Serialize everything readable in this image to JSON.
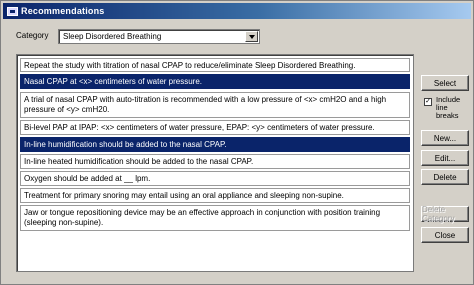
{
  "window": {
    "title": "Recommendations"
  },
  "category": {
    "label": "Category",
    "selected": "Sleep Disordered Breathing"
  },
  "recommendations": [
    {
      "text": "Repeat the study with titration of nasal CPAP to reduce/eliminate Sleep Disordered Breathing.",
      "selected": false
    },
    {
      "text": "Nasal CPAP at <x> centimeters of water pressure.",
      "selected": true
    },
    {
      "text": "A trial of nasal CPAP with auto-titration is recommended with a low pressure of <x> cmH2O and a high pressure of <y> cmH20.",
      "selected": false
    },
    {
      "text": "Bi-level PAP at IPAP: <x> centimeters of water pressure, EPAP: <y> centimeters of water pressure.",
      "selected": false
    },
    {
      "text": "In-line humidification should be added to the nasal CPAP.",
      "selected": true
    },
    {
      "text": "In-line heated humidification should be added to the nasal CPAP.",
      "selected": false
    },
    {
      "text": "Oxygen should be added at __ lpm.",
      "selected": false
    },
    {
      "text": "Treatment for primary snoring may entail using an oral appliance and sleeping non-supine.",
      "selected": false
    },
    {
      "text": "Jaw or tongue repositioning device may be an effective approach in conjunction with position training (sleeping non-supine).",
      "selected": false
    }
  ],
  "buttons": {
    "select": "Select",
    "new": "New...",
    "edit": "Edit...",
    "delete": "Delete",
    "delete_category": "Delete Category",
    "close": "Close"
  },
  "include_line_breaks": {
    "label": "Include line breaks",
    "checked": true,
    "mark": "✓"
  }
}
